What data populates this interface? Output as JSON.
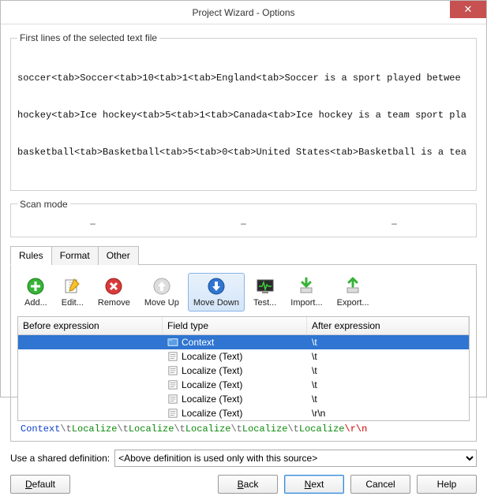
{
  "window": {
    "title": "Project Wizard - Options"
  },
  "group1": {
    "legend": "First lines of the selected text file",
    "lines": [
      "soccer<tab>Soccer<tab>10<tab>1<tab>England<tab>Soccer is a sport played betwee",
      "hockey<tab>Ice hockey<tab>5<tab>1<tab>Canada<tab>Ice hockey is a team sport pla",
      "basketball<tab>Basketball<tab>5<tab>0<tab>United States<tab>Basketball is a tea"
    ]
  },
  "group2": {
    "legend": "Scan mode",
    "cells": [
      "–",
      "–",
      "–"
    ]
  },
  "tabs": {
    "rules": "Rules",
    "format": "Format",
    "other": "Other"
  },
  "toolbar": {
    "add": "Add...",
    "edit": "Edit...",
    "remove": "Remove",
    "moveup": "Move Up",
    "movedown": "Move Down",
    "test": "Test...",
    "import": "Import...",
    "export": "Export..."
  },
  "grid": {
    "headers": {
      "before": "Before expression",
      "field": "Field type",
      "after": "After expression"
    },
    "rows": [
      {
        "before": "",
        "field": "Context",
        "after": "\\t",
        "icon": "context",
        "selected": true
      },
      {
        "before": "",
        "field": "Localize (Text)",
        "after": "\\t",
        "icon": "text"
      },
      {
        "before": "",
        "field": "Localize (Text)",
        "after": "\\t",
        "icon": "text"
      },
      {
        "before": "",
        "field": "Localize (Text)",
        "after": "\\t",
        "icon": "text"
      },
      {
        "before": "",
        "field": "Localize (Text)",
        "after": "\\t",
        "icon": "text"
      },
      {
        "before": "",
        "field": "Localize (Text)",
        "after": "\\r\\n",
        "icon": "text"
      }
    ]
  },
  "expression": [
    {
      "t": "Context",
      "c": "c-blue"
    },
    {
      "t": "\\t",
      "c": "c-gray"
    },
    {
      "t": "Localize",
      "c": "c-green"
    },
    {
      "t": "\\t",
      "c": "c-gray"
    },
    {
      "t": "Localize",
      "c": "c-green"
    },
    {
      "t": "\\t",
      "c": "c-gray"
    },
    {
      "t": "Localize",
      "c": "c-green"
    },
    {
      "t": "\\t",
      "c": "c-gray"
    },
    {
      "t": "Localize",
      "c": "c-green"
    },
    {
      "t": "\\t",
      "c": "c-gray"
    },
    {
      "t": "Localize",
      "c": "c-green"
    },
    {
      "t": "\\r\\n",
      "c": "c-red"
    }
  ],
  "shared": {
    "label": "Use a shared definition:",
    "value": "<Above definition is used only with this source>"
  },
  "buttons": {
    "default": "Default",
    "back": "Back",
    "next": "Next",
    "cancel": "Cancel",
    "help": "Help"
  }
}
